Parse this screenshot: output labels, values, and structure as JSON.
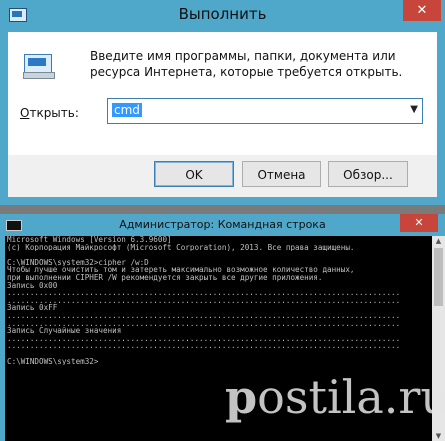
{
  "run_dialog": {
    "title": "Выполнить",
    "close": "✕",
    "description": "Введите имя программы, папки, документа или ресурса Интернета, которые требуется открыть.",
    "open_label_accel": "О",
    "open_label_rest": "ткрыть:",
    "command_value": "cmd",
    "buttons": {
      "ok": "OK",
      "cancel": "Отмена",
      "browse": "Обзор..."
    }
  },
  "console_window": {
    "title": "Администратор: Командная строка",
    "close": "✕",
    "lines": [
      "Microsoft Windows [Version 6.3.9600]",
      "(c) Корпорация Майкрософт (Microsoft Corporation), 2013. Все права защищены.",
      "",
      "C:\\WINDOWS\\system32>cipher /w:D",
      "Чтобы лучше очистить том и затереть максимально возможное количество данных,",
      "при выполнении CIPHER /W рекомендуется закрыть все другие приложения.",
      "Запись 0x00",
      "......................................................................................",
      "......................................................................................",
      "Запись 0xFF",
      "......................................................................................",
      "......................................................................................",
      "Запись Случайные значения",
      "......................................................................................",
      "......................................................................................",
      "",
      "C:\\WINDOWS\\system32>"
    ]
  },
  "watermark": {
    "prefix": "p",
    "text": "ostila.ru"
  }
}
